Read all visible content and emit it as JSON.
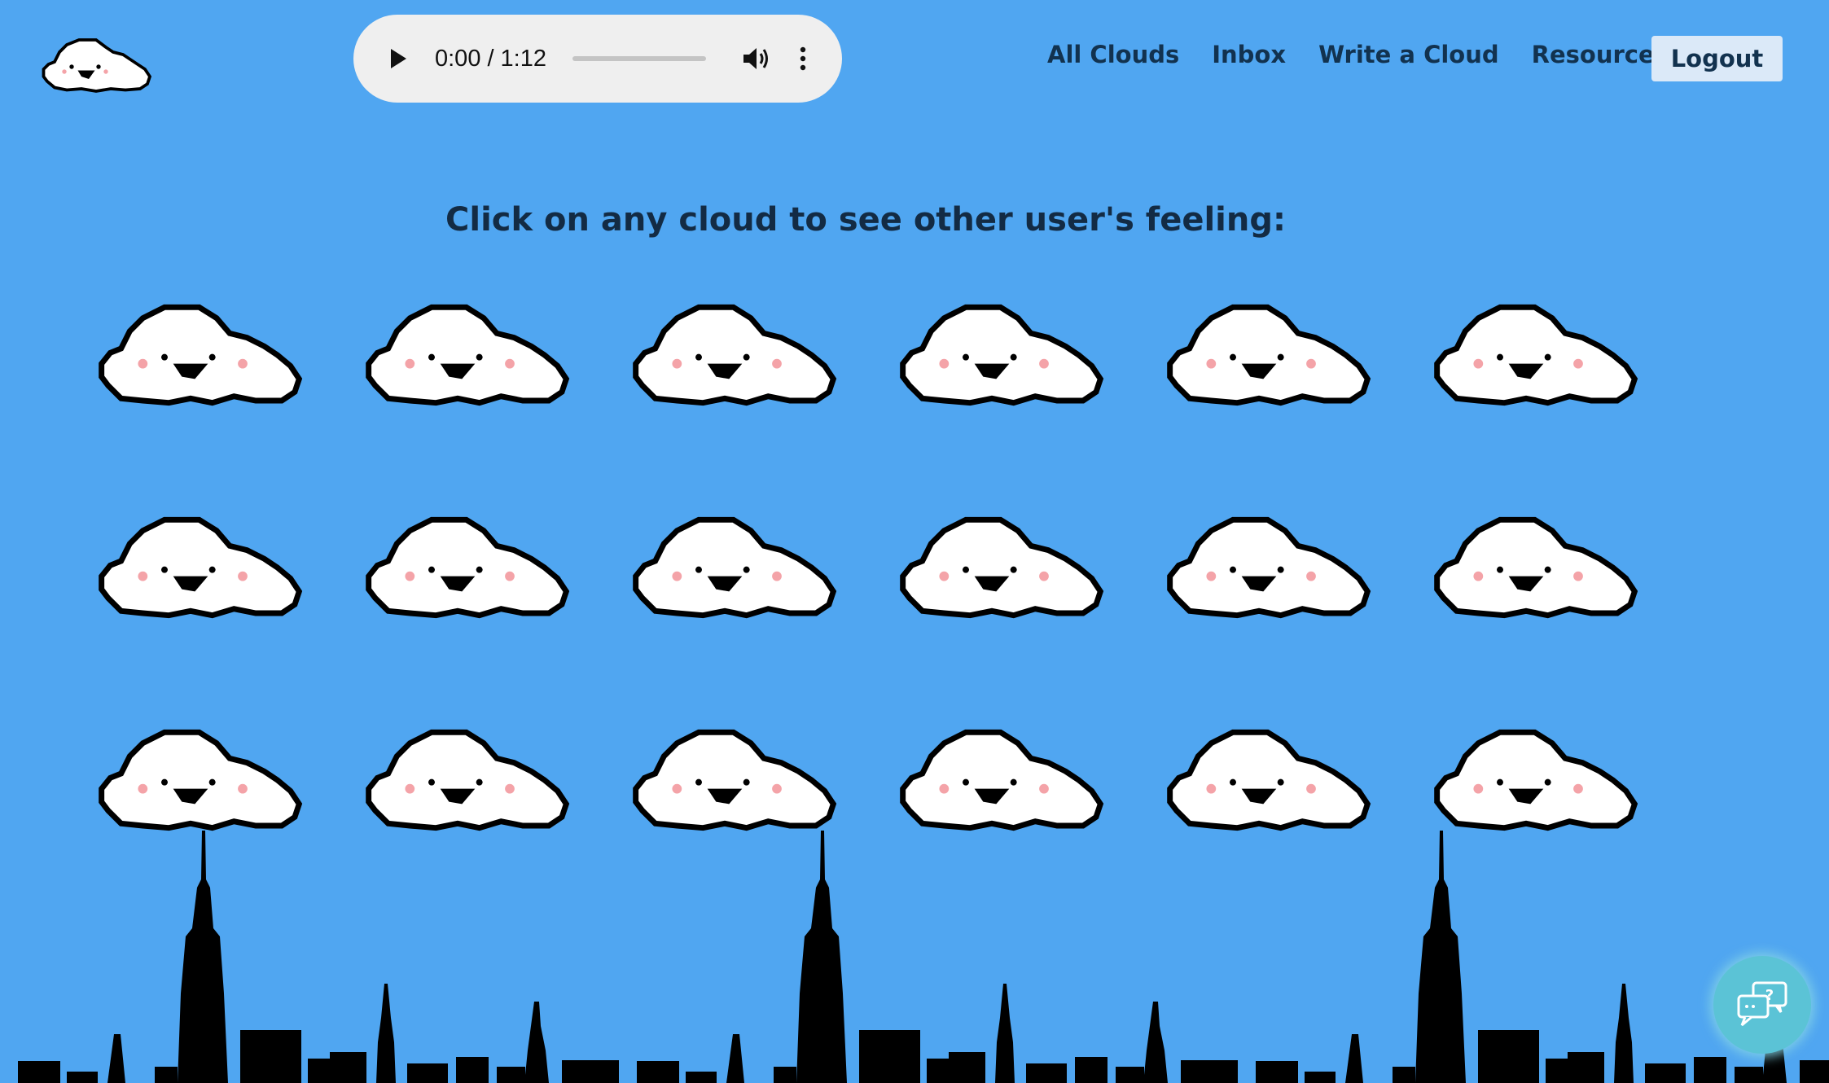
{
  "audio": {
    "current_time": "0:00",
    "separator": "/",
    "duration": "1:12",
    "progress": 0
  },
  "nav": {
    "items": [
      "All Clouds",
      "Inbox",
      "Write a Cloud",
      "Resources"
    ],
    "logout_label": "Logout"
  },
  "main": {
    "prompt": "Click on any cloud to see other user's feeling:",
    "cloud_count": 18
  },
  "colors": {
    "background": "#50a6f1",
    "nav_text": "#12324f",
    "logout_bg": "#dbe9f8",
    "help_button": "#5bc3d6",
    "cloud_blush": "#f4a3a8"
  },
  "icons": {
    "logo": "cloud-face-icon",
    "play": "play-icon",
    "volume": "volume-icon",
    "menu": "kebab-menu-icon",
    "help": "chat-help-icon"
  }
}
